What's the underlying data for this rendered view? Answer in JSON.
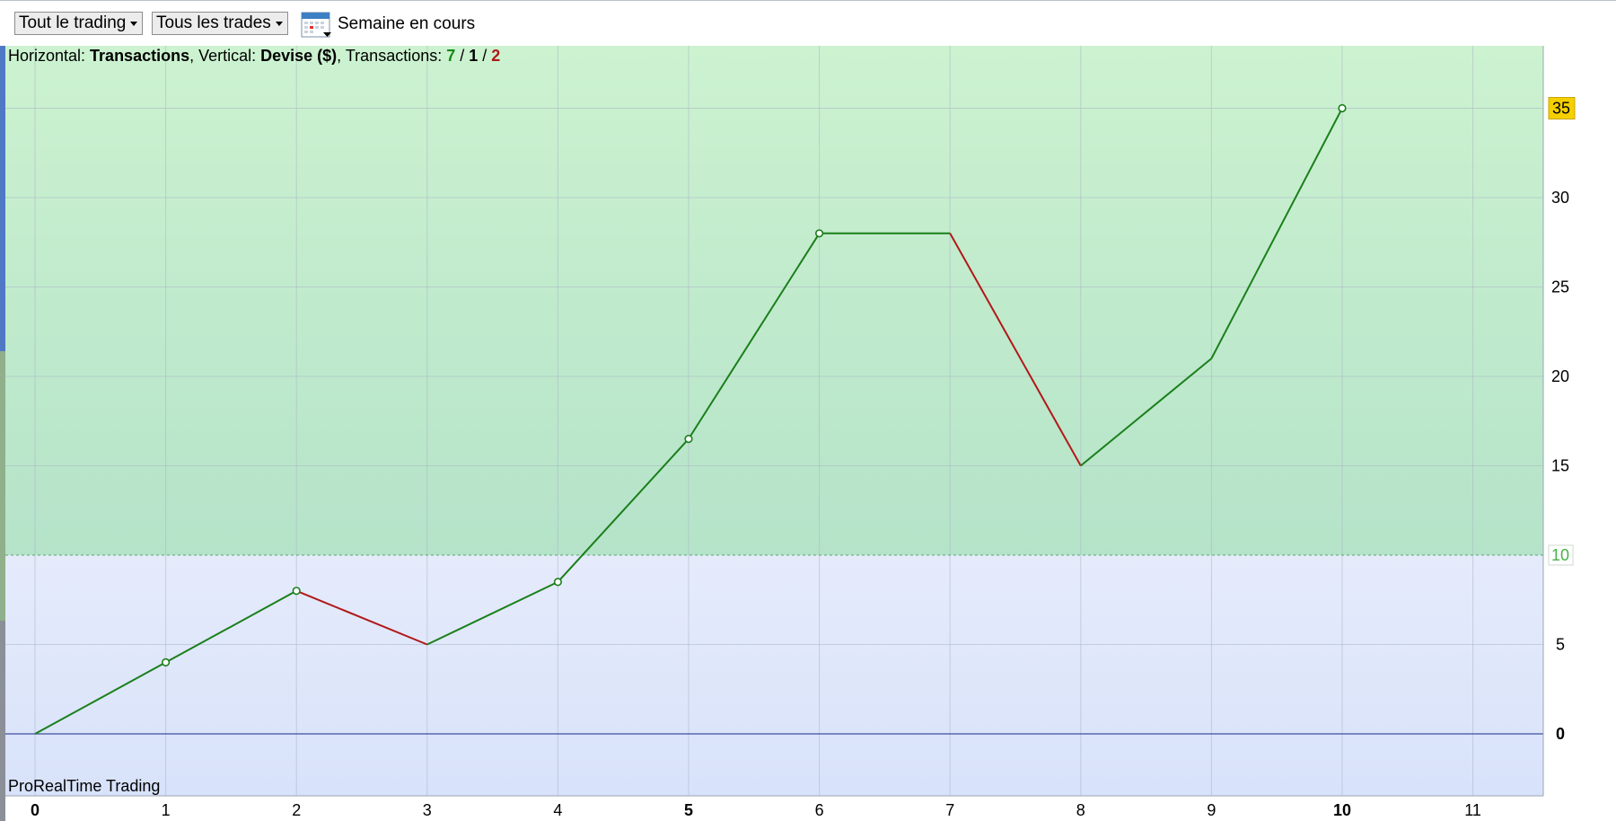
{
  "toolbar": {
    "scope_dropdown": "Tout le trading",
    "trades_dropdown": "Tous les trades",
    "period_label": "Semaine en cours",
    "calendar_icon": "calendar-icon"
  },
  "header": {
    "h_prefix": "Horizontal: ",
    "h_value": "Transactions",
    "v_prefix": ", Vertical: ",
    "v_value": "Devise ($)",
    "t_prefix": ", Transactions: ",
    "t_win": "7",
    "sep1": " / ",
    "t_neutral": "1",
    "sep2": " / ",
    "t_loss": "2"
  },
  "watermark": "ProRealTime Trading",
  "colors": {
    "gain": "#1a7f1a",
    "loss": "#b01919",
    "profit_zone": "#c5efcc",
    "base_zone": "#dde6fb",
    "last_value_badge": "#f5d000",
    "threshold_label": "#46b446"
  },
  "chart_data": {
    "type": "line",
    "title": "",
    "xlabel": "Transactions",
    "ylabel": "Devise ($)",
    "x": [
      0,
      1,
      2,
      3,
      4,
      5,
      6,
      7,
      8,
      9,
      10
    ],
    "y": [
      0,
      4,
      8,
      5,
      8.5,
      16.5,
      28,
      28,
      15,
      21,
      35
    ],
    "segment_result": [
      "gain",
      "gain",
      "loss",
      "gain",
      "gain",
      "gain",
      "neutral",
      "loss",
      "gain",
      "gain"
    ],
    "marker_indices": [
      1,
      2,
      4,
      5,
      6,
      10
    ],
    "xlim": [
      0,
      11.5
    ],
    "ylim": [
      -3.5,
      38.5
    ],
    "x_ticks": [
      0,
      1,
      2,
      3,
      4,
      5,
      6,
      7,
      8,
      9,
      10,
      11
    ],
    "x_bold_ticks": [
      0,
      5,
      10
    ],
    "y_ticks": [
      0,
      5,
      10,
      15,
      20,
      25,
      30,
      35
    ],
    "last_value": "35",
    "threshold": 10,
    "threshold_label": "10",
    "grid": true
  }
}
